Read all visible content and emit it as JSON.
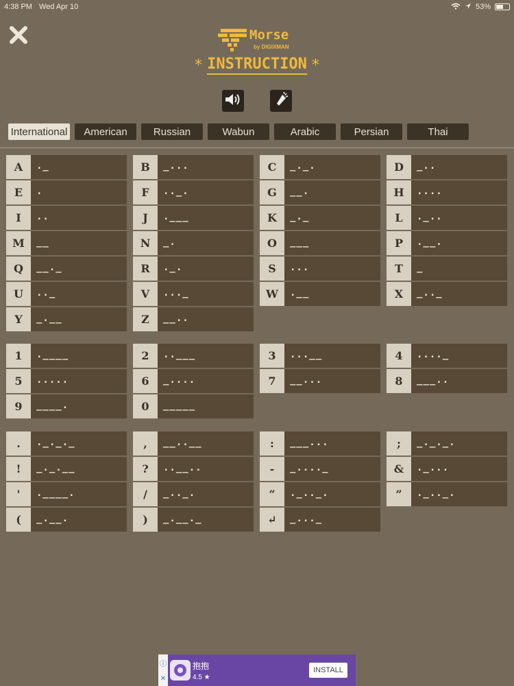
{
  "status_bar": {
    "time": "4:38 PM",
    "date": "Wed Apr 10",
    "battery": "53%"
  },
  "app": {
    "logo_name": "Morse",
    "logo_by": "by DIGIXMAN",
    "title": "INSTRUCTION",
    "title_star": "*"
  },
  "icons": {
    "close": "close-icon",
    "sound": "speaker-icon",
    "flash": "flashlight-icon"
  },
  "colors": {
    "accent": "#f0b93c",
    "background": "#756a59",
    "code_cell": "#574935",
    "key_cell": "#d8d0c0"
  },
  "tabs": [
    {
      "label": "International",
      "active": true
    },
    {
      "label": "American"
    },
    {
      "label": "Russian"
    },
    {
      "label": "Wabun"
    },
    {
      "label": "Arabic"
    },
    {
      "label": "Persian"
    },
    {
      "label": "Thai"
    }
  ],
  "letters": [
    {
      "key": "A",
      "code": "._"
    },
    {
      "key": "B",
      "code": "_..."
    },
    {
      "key": "C",
      "code": "_._."
    },
    {
      "key": "D",
      "code": "_.."
    },
    {
      "key": "E",
      "code": "."
    },
    {
      "key": "F",
      "code": ".._."
    },
    {
      "key": "G",
      "code": "__."
    },
    {
      "key": "H",
      "code": "...."
    },
    {
      "key": "I",
      "code": ".."
    },
    {
      "key": "J",
      "code": ".___"
    },
    {
      "key": "K",
      "code": "_._"
    },
    {
      "key": "L",
      "code": "._.."
    },
    {
      "key": "M",
      "code": "__"
    },
    {
      "key": "N",
      "code": "_."
    },
    {
      "key": "O",
      "code": "___"
    },
    {
      "key": "P",
      "code": ".__."
    },
    {
      "key": "Q",
      "code": "__._"
    },
    {
      "key": "R",
      "code": "._."
    },
    {
      "key": "S",
      "code": "..."
    },
    {
      "key": "T",
      "code": "_"
    },
    {
      "key": "U",
      "code": ".._"
    },
    {
      "key": "V",
      "code": "..._"
    },
    {
      "key": "W",
      "code": ".__"
    },
    {
      "key": "X",
      "code": "_.._"
    },
    {
      "key": "Y",
      "code": "_.__"
    },
    {
      "key": "Z",
      "code": "__.."
    }
  ],
  "numbers": [
    {
      "key": "1",
      "code": ".____"
    },
    {
      "key": "2",
      "code": "..___"
    },
    {
      "key": "3",
      "code": "...__"
    },
    {
      "key": "4",
      "code": "...._"
    },
    {
      "key": "5",
      "code": "....."
    },
    {
      "key": "6",
      "code": "_...."
    },
    {
      "key": "7",
      "code": "__..."
    },
    {
      "key": "8",
      "code": "___.."
    },
    {
      "key": "9",
      "code": "____."
    },
    {
      "key": "0",
      "code": "_____"
    }
  ],
  "symbols": [
    {
      "key": ".",
      "code": "._._._"
    },
    {
      "key": ",",
      "code": "__..__"
    },
    {
      "key": ":",
      "code": "___..."
    },
    {
      "key": ";",
      "code": "_._._."
    },
    {
      "key": "!",
      "code": "_._.__"
    },
    {
      "key": "?",
      "code": "..__.."
    },
    {
      "key": "-",
      "code": "_...._"
    },
    {
      "key": "&",
      "code": "._..."
    },
    {
      "key": "'",
      "code": ".____."
    },
    {
      "key": "/",
      "code": "_.._."
    },
    {
      "key": "“",
      "code": "._.._."
    },
    {
      "key": "”",
      "code": "._.._."
    },
    {
      "key": "(",
      "code": "_.__."
    },
    {
      "key": ")",
      "code": "_.__._"
    },
    {
      "key": "↵",
      "code": "_..._"
    }
  ],
  "ad": {
    "app_name": "抱抱",
    "rating": "4.5 ★",
    "install_label": "INSTALL"
  }
}
